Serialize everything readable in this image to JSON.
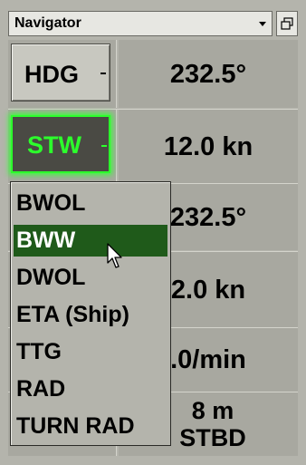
{
  "window": {
    "title": "Navigator"
  },
  "rows": [
    {
      "mode": "HDG",
      "value": "232.5°",
      "active": false
    },
    {
      "mode": "STW",
      "value": "12.0 kn",
      "active": true
    },
    {
      "value": "232.5°"
    },
    {
      "value": "2.0 kn"
    },
    {
      "value": ".0/min"
    },
    {
      "value_line1": "8 m",
      "value_line2": "STBD"
    }
  ],
  "dropdown": {
    "items": [
      "BWOL",
      "BWW",
      "DWOL",
      "ETA (Ship)",
      "TTG",
      "RAD",
      "TURN RAD"
    ],
    "selected": "BWW"
  },
  "colors": {
    "panel_bg": "#b4b4ac",
    "active_green": "#2cff2c",
    "selected_bg": "#1f5a1a"
  },
  "icons": {
    "title_dropdown": "chevron-down-icon",
    "restore": "restore-window-icon",
    "cursor": "mouse-pointer-icon"
  }
}
